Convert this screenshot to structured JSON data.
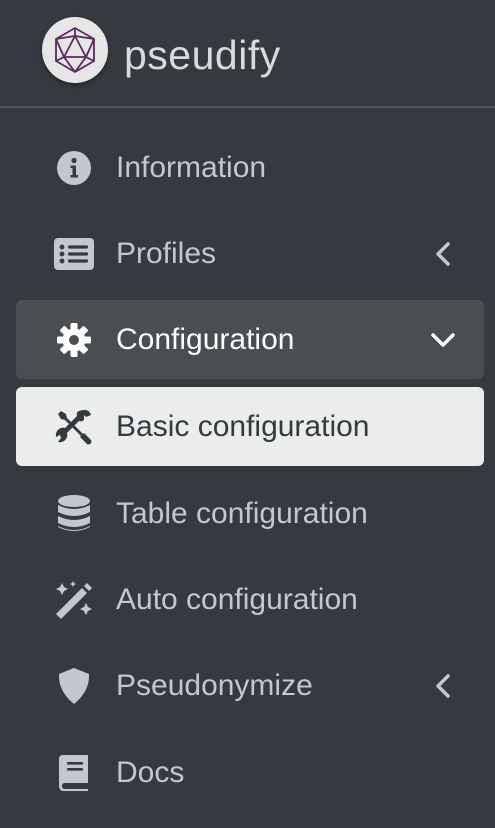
{
  "brand": {
    "name": "pseudify",
    "logo_icon": "icosahedron-logo"
  },
  "colors": {
    "sidebar_bg": "#343a40",
    "open_item_bg": "#494e53",
    "active_item_bg": "#ebecec",
    "text": "#c2c7d0",
    "logo_stroke": "#5a2a5e"
  },
  "nav": {
    "items": [
      {
        "label": "Information",
        "icon": "info-circle-icon"
      },
      {
        "label": "Profiles",
        "icon": "list-icon",
        "arrow": "chevron-left-icon"
      },
      {
        "label": "Configuration",
        "icon": "gear-icon",
        "arrow": "chevron-down-icon",
        "state": "open"
      },
      {
        "label": "Basic configuration",
        "icon": "tools-icon",
        "state": "active"
      },
      {
        "label": "Table configuration",
        "icon": "database-icon"
      },
      {
        "label": "Auto configuration",
        "icon": "magic-wand-icon"
      },
      {
        "label": "Pseudonymize",
        "icon": "shield-icon",
        "arrow": "chevron-left-icon"
      },
      {
        "label": "Docs",
        "icon": "book-icon"
      }
    ]
  }
}
